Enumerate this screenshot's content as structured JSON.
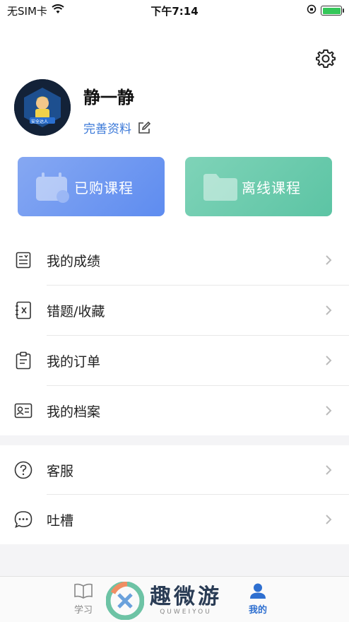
{
  "status_bar": {
    "carrier": "无SIM卡",
    "time": "下午7:14"
  },
  "profile": {
    "name": "静一静",
    "edit_label": "完善资料",
    "avatar_badge": "安全达人"
  },
  "cards": {
    "purchased": "已购课程",
    "offline": "离线课程"
  },
  "menu": {
    "scores": "我的成绩",
    "wrong_favorites": "错题/收藏",
    "orders": "我的订单",
    "archive": "我的档案",
    "service": "客服",
    "feedback": "吐槽"
  },
  "tabs": {
    "study": "学习",
    "mine": "我的"
  },
  "watermark": {
    "main": "趣微游",
    "sub": "QUWEIYOU"
  },
  "colors": {
    "accent": "#2e6fd0",
    "card_purchased": "#6f97f0",
    "card_offline": "#66c8a9",
    "battery": "#34c759"
  }
}
